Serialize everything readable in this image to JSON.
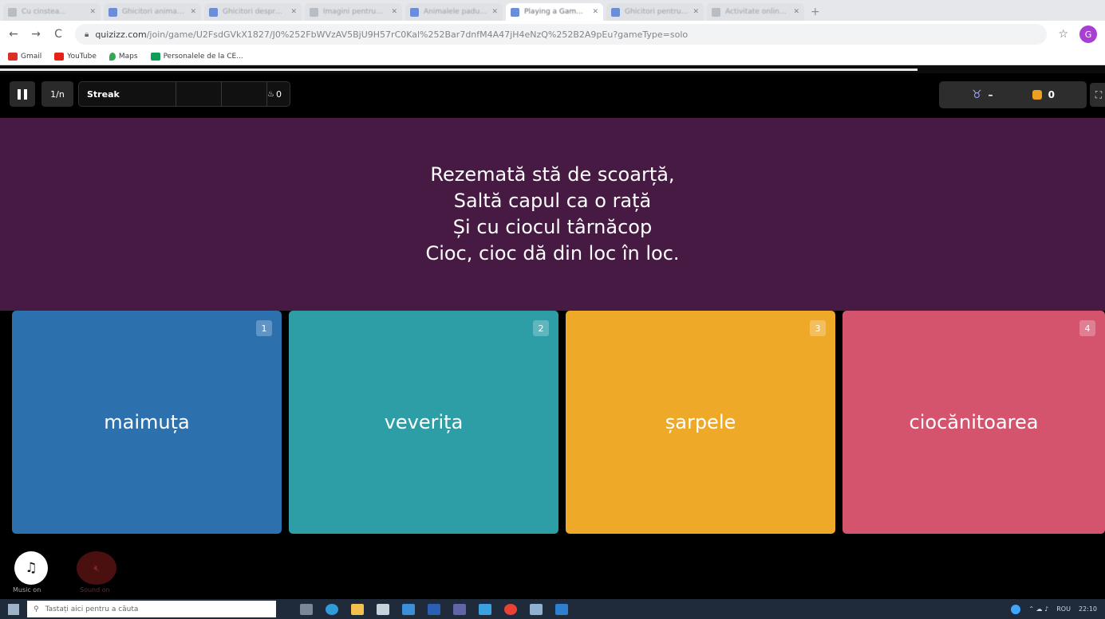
{
  "browser": {
    "tabs": [
      {
        "title": "Cu cinstea..."
      },
      {
        "title": "Ghicitori animale..."
      },
      {
        "title": "Ghicitori despre..."
      },
      {
        "title": "Imagini pentru..."
      },
      {
        "title": "Animalele padurii..."
      },
      {
        "title": "Playing a Gam..."
      },
      {
        "title": "Ghicitori pentru..."
      },
      {
        "title": "Activitate online..."
      }
    ],
    "url_domain": "quizizz.com",
    "url_path": "/join/game/U2FsdGVkX1827/J0%252FbWVzAV5BjU9H57rC0Kal%252Bar7dnfM4A47jH4eNzQ%252B2A9pEu?gameType=solo",
    "profile_initial": "G",
    "bookmarks": [
      {
        "label": "Gmail",
        "color": "#d93025"
      },
      {
        "label": "YouTube",
        "color": "#e62117"
      },
      {
        "label": "Maps",
        "color": "#34a853"
      },
      {
        "label": "Personalele de la CE...",
        "color": "#0f9d58"
      }
    ]
  },
  "game": {
    "progress_fraction": 0.83,
    "question_counter": "1/n",
    "streak_label": "Streak",
    "streak_count": "0",
    "mask_value": "–",
    "coins_value": "0",
    "question_lines": [
      "Rezemată stă de scoarță,",
      "Saltă capul ca o rață",
      "Și cu ciocul târnăcop",
      "Cioc, cioc dă din loc în loc."
    ],
    "options": [
      {
        "number": "1",
        "label": "maimuța",
        "color": "#2d70ae"
      },
      {
        "number": "2",
        "label": "veverița",
        "color": "#2d9da6"
      },
      {
        "number": "3",
        "label": "șarpele",
        "color": "#efa929"
      },
      {
        "number": "4",
        "label": "ciocănitoarea",
        "color": "#d5546d"
      }
    ],
    "music_label": "Music on",
    "sound_label": "Sound on"
  },
  "taskbar": {
    "search_placeholder": "Tastați aici pentru a căuta",
    "lang": "ROU",
    "time": "22:10"
  }
}
